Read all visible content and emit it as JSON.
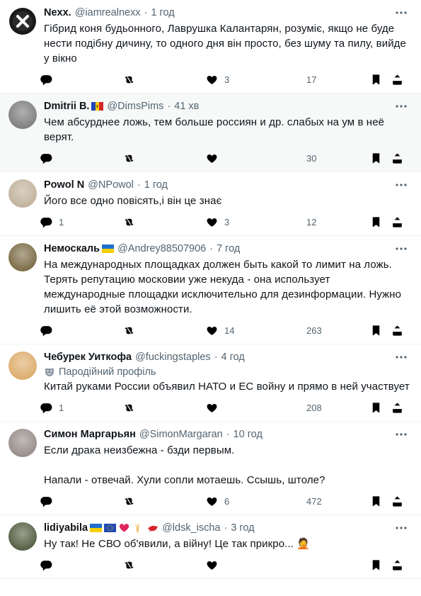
{
  "tweets": [
    {
      "name": "Nexx.",
      "flags": "",
      "handle": "@iamrealnexx",
      "time": "1 год",
      "text": [
        "Гібрид коня будьонного, Лаврушка Калантарян, розуміє, якщо не буде нести подібну дичину, то одного дня він просто, без шуму та пилу, вийде у вікно"
      ],
      "replies": "",
      "reposts": "",
      "likes": "3",
      "views": "17",
      "avatar_color": "#1d1d1d",
      "highlight": false
    },
    {
      "name": "Dmitrii B.",
      "flags": "moldova",
      "handle": "@DimsPims",
      "time": "41 хв",
      "text": [
        "Чем абсурднее ложь, тем больше россиян и др. слабых на ум в неё верят."
      ],
      "replies": "",
      "reposts": "",
      "likes": "",
      "views": "30",
      "avatar_color": "#6f6f6f",
      "highlight": true
    },
    {
      "name": "Powol N",
      "flags": "",
      "handle": "@NPowol",
      "time": "1 год",
      "text": [
        "Його все одно повісять,і він це знає"
      ],
      "replies": "1",
      "reposts": "",
      "likes": "3",
      "views": "12",
      "avatar_color": "#b9a88f",
      "highlight": false
    },
    {
      "name": "Немоскаль",
      "flags": "ukraine",
      "handle": "@Andrey88507906",
      "time": "7 год",
      "text": [
        "На международных площадках должен быть какой то лимит на ложь. Терять репутацию московии уже некуда - она использует международные площадки исключительно для дезинформации. Нужно лишить её этой возможности."
      ],
      "replies": "",
      "reposts": "",
      "likes": "14",
      "views": "263",
      "avatar_color": "#6b5a2f",
      "highlight": false
    },
    {
      "name": "Чебурек Уиткофа",
      "flags": "",
      "handle": "@fuckingstaples",
      "time": "4 год",
      "parody": "Пародійний профіль",
      "text": [
        "Китай руками России объявил НАТО и ЕС войну и прямо в ней участвует"
      ],
      "replies": "1",
      "reposts": "",
      "likes": "",
      "views": "208",
      "avatar_color": "#d9a25a",
      "highlight": false
    },
    {
      "name": "Симон Маргарьян",
      "flags": "",
      "handle": "@SimonMargaran",
      "time": "10 год",
      "text": [
        "Если драка неизбежна - бзди первым.",
        "",
        "Напали - отвечай. Хули сопли мотаешь. Ссышь, штоле?"
      ],
      "replies": "",
      "reposts": "",
      "likes": "6",
      "views": "472",
      "avatar_color": "#8a7f7a",
      "highlight": false
    },
    {
      "name": "lidiyabila",
      "flags": "ukraine-eu-heart-hand-bird",
      "handle": "@ldsk_ischa",
      "time": "3 год",
      "text": [
        "Ну так! Не СВО об'явили, а війну! Це так прикро... 🤦"
      ],
      "replies": "",
      "reposts": "",
      "likes": "",
      "views": "",
      "avatar_color": "#3f4a2a",
      "highlight": false
    }
  ],
  "icons": {
    "reply": "reply-icon",
    "repost": "repost-icon",
    "like": "heart-icon",
    "views": "views-icon",
    "bookmark": "bookmark-icon",
    "share": "share-icon",
    "more": "more-icon"
  }
}
